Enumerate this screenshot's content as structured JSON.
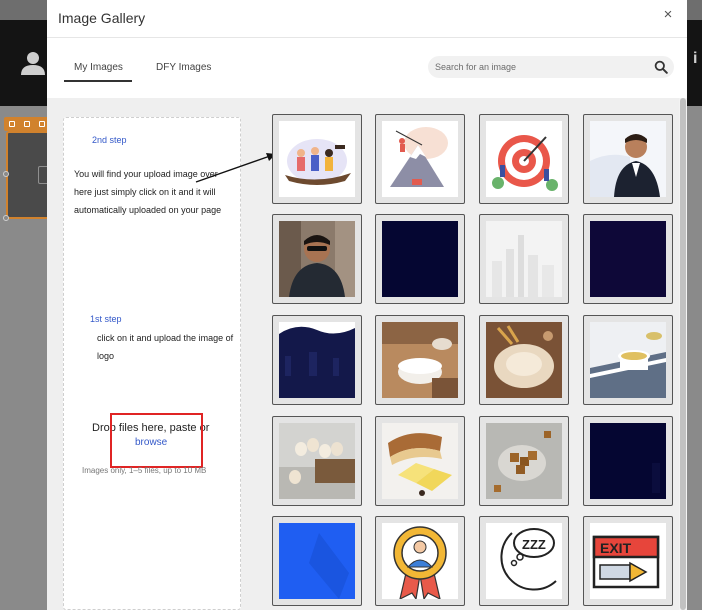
{
  "modal": {
    "title": "Image Gallery",
    "close_glyph": "×"
  },
  "tabs": [
    {
      "label": "My Images",
      "active": true
    },
    {
      "label": "DFY Images",
      "active": false
    }
  ],
  "search": {
    "placeholder": "Search for an image",
    "value": ""
  },
  "upload": {
    "step2_label": "2nd step",
    "step2_note": "You will find your upload image over here just simply click on it and it will automatically uploaded on your page",
    "step1_label": "1st step",
    "step1_note": "click on it and upload the image of logo",
    "drop_text": "Drop files here, paste or",
    "browse_label": "browse",
    "hint": "Images only, 1–5 files, up to 10 MB"
  },
  "images": [
    {
      "icon": "team-boat-illustration-icon"
    },
    {
      "icon": "mountain-climb-illustration-icon"
    },
    {
      "icon": "target-goal-illustration-icon"
    },
    {
      "icon": "man-in-suit-photo-icon"
    },
    {
      "icon": "man-with-sunglasses-photo-icon"
    },
    {
      "icon": "dark-navy-image-icon"
    },
    {
      "icon": "faded-city-skyline-icon"
    },
    {
      "icon": "dark-purple-image-icon"
    },
    {
      "icon": "navy-wave-banner-icon"
    },
    {
      "icon": "flour-bowl-photo-icon"
    },
    {
      "icon": "flour-wheat-photo-icon"
    },
    {
      "icon": "tea-cup-photo-icon"
    },
    {
      "icon": "eggs-in-crate-photo-icon"
    },
    {
      "icon": "bread-and-butter-photo-icon"
    },
    {
      "icon": "brown-sugar-cubes-photo-icon"
    },
    {
      "icon": "dark-navy-image-icon"
    },
    {
      "icon": "blue-abstract-image-icon"
    },
    {
      "icon": "employee-award-badge-icon"
    },
    {
      "icon": "moon-sleep-zzz-icon"
    },
    {
      "icon": "exit-sign-icon"
    }
  ],
  "colors": {
    "accent_blue": "#3459c9",
    "highlight_red": "#e02424",
    "block_orange": "#d1822d"
  }
}
